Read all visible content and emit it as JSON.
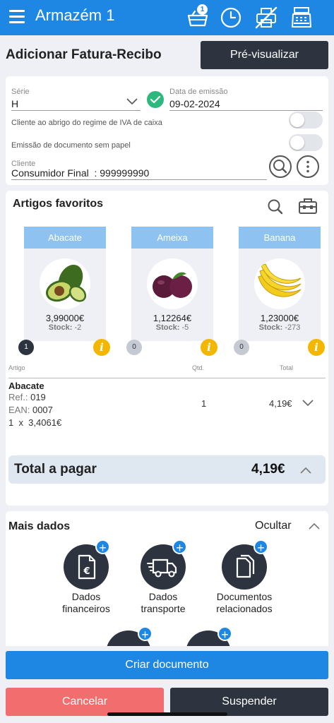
{
  "topbar": {
    "title": "Armazém 1",
    "cart_badge": "1",
    "icons": [
      "menu-icon",
      "basket-icon",
      "clock-icon",
      "printer-off-icon",
      "cash-register-icon"
    ]
  },
  "page": {
    "title": "Adicionar Fatura-Recibo",
    "preview_label": "Pré-visualizar"
  },
  "form": {
    "serie_label": "Série",
    "serie_value": "H",
    "date_label": "Data de emissão",
    "date_value": "09-02-2024",
    "vat_cash_label": "Cliente ao abrigo do regime de IVA de caixa",
    "paperless_label": "Emissão de documento sem papel",
    "client_label": "Cliente",
    "client_value": "Consumidor Final  : 999999990"
  },
  "favorites": {
    "title": "Artigos favoritos",
    "items": [
      {
        "name": "Abacate",
        "price": "3,99000€",
        "stock_label": "Stock:",
        "stock_value": "-2",
        "qty": "1"
      },
      {
        "name": "Ameixa",
        "price": "1,12264€",
        "stock_label": "Stock:",
        "stock_value": "-5",
        "qty": "0"
      },
      {
        "name": "Banana",
        "price": "1,23000€",
        "stock_label": "Stock:",
        "stock_value": "-273",
        "qty": "0"
      }
    ],
    "info_glyph": "i"
  },
  "lines": {
    "headers": {
      "article": "Artigo",
      "qty": "Qtd.",
      "total": "Total"
    },
    "items": [
      {
        "name": "Abacate",
        "ref_label": "Ref.:",
        "ref_value": "019",
        "ean_label": "EAN:",
        "ean_value": "0007",
        "unit_line": "1  x  3,4061€",
        "qty": "1",
        "total": "4,19€"
      }
    ]
  },
  "total": {
    "label": "Total a pagar",
    "value": "4,19€"
  },
  "more": {
    "title": "Mais dados",
    "toggle_label": "Ocultar",
    "actions": [
      {
        "line1": "Dados",
        "line2": "financeiros"
      },
      {
        "line1": "Dados",
        "line2": "transporte"
      },
      {
        "line1": "Documentos",
        "line2": "relacionados"
      }
    ]
  },
  "buttons": {
    "create": "Criar documento",
    "cancel": "Cancelar",
    "suspend": "Suspender"
  },
  "colors": {
    "primary": "#1e86e3",
    "dark": "#2d3440",
    "danger": "#f26d6d",
    "success": "#2db87d",
    "warning": "#f3b700"
  }
}
